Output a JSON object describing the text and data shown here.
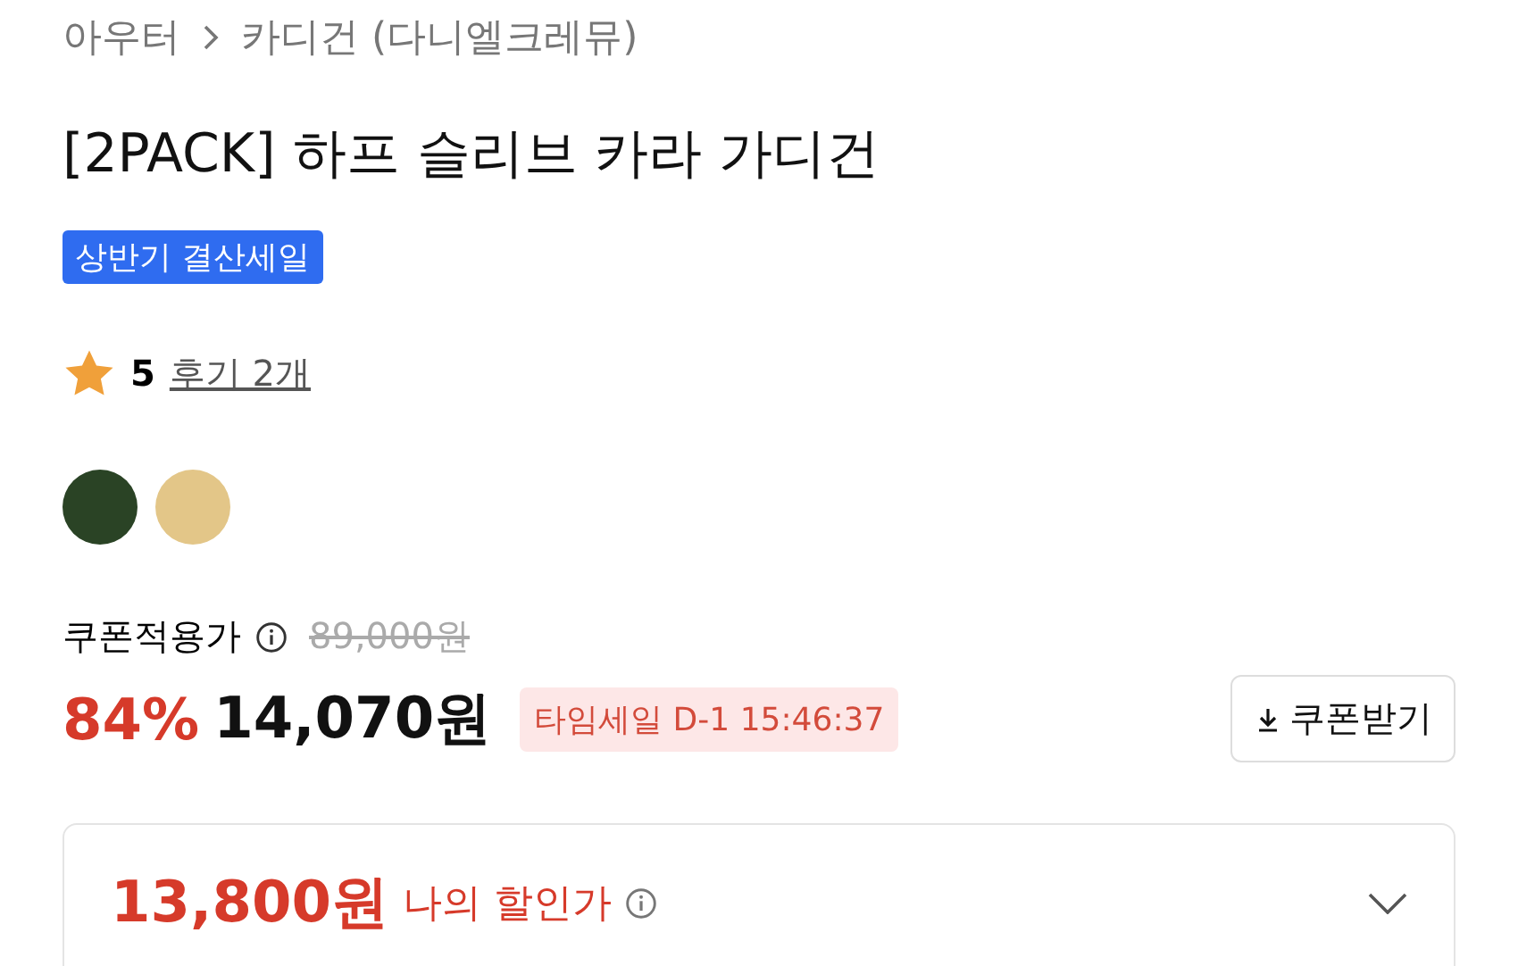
{
  "breadcrumb": [
    {
      "label": "아우터"
    },
    {
      "label": "카디건 (다니엘크레뮤)"
    }
  ],
  "title": "[2PACK] 하프 슬리브 카라 가디건",
  "badge": "상반기 결산세일",
  "rating": {
    "score": "5",
    "reviews": "후기 2개"
  },
  "swatches": [
    {
      "color": "#2a4325"
    },
    {
      "color": "#e3c688"
    }
  ],
  "price": {
    "coupon_label": "쿠폰적용가",
    "original": "89,000원",
    "discount": "84%",
    "final": "14,070원",
    "timer": "타임세일 D-1 15:46:37",
    "coupon_button": "쿠폰받기"
  },
  "my_price": {
    "amount": "13,800원",
    "label": "나의 할인가",
    "expanded": false
  }
}
